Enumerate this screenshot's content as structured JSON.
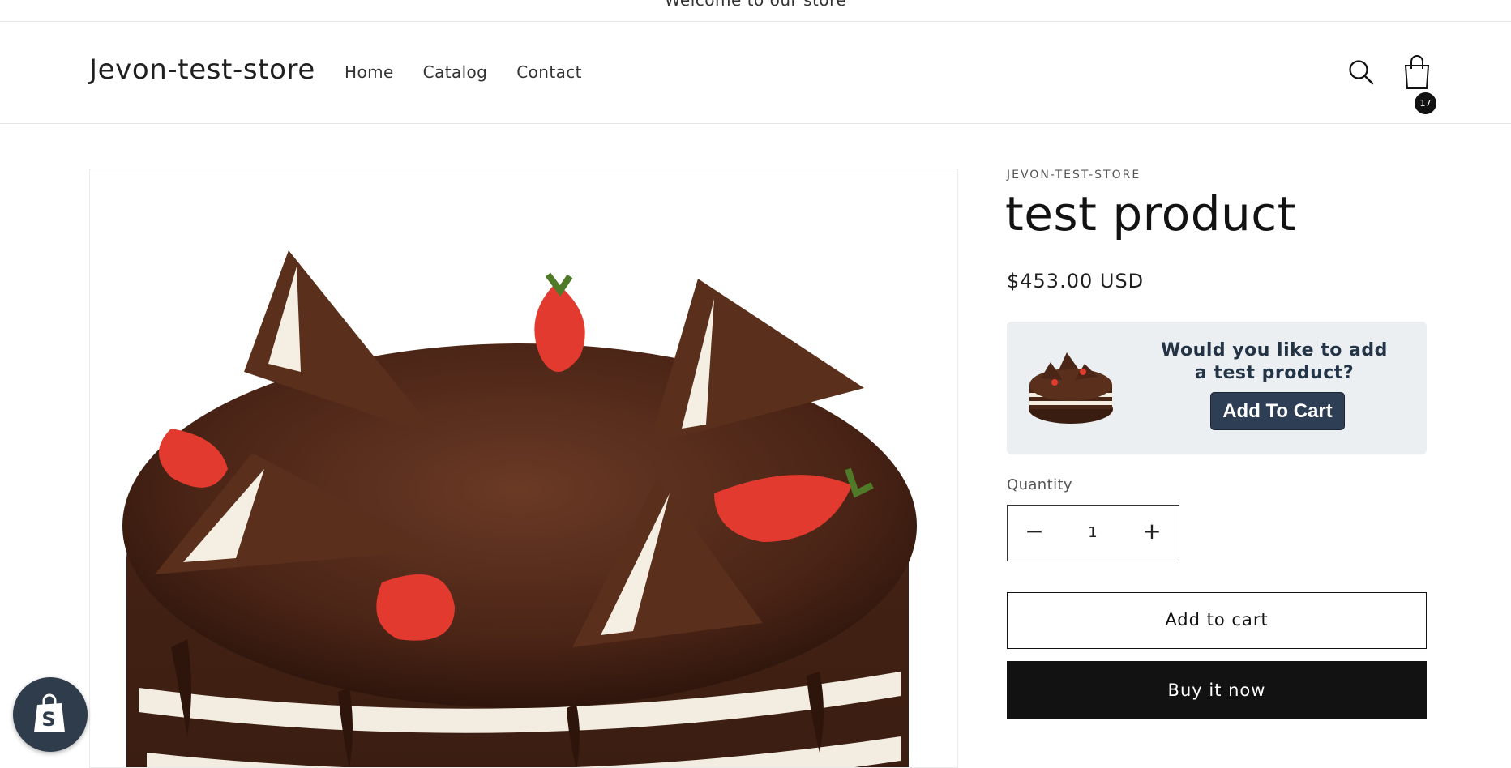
{
  "announcement": {
    "text": "Welcome to our store"
  },
  "header": {
    "logo": "Jevon-test-store",
    "nav": [
      "Home",
      "Catalog",
      "Contact"
    ],
    "cart_count": "17"
  },
  "icons": {
    "search": "search-icon",
    "cart": "cart-icon",
    "shopify": "shopify-bag-icon"
  },
  "product": {
    "vendor": "JEVON-TEST-STORE",
    "title": "test product",
    "price": "$453.00 USD",
    "quantity_label": "Quantity",
    "quantity_value": "1",
    "add_to_cart": "Add to cart",
    "buy_now": "Buy it now"
  },
  "upsell": {
    "prompt": "Would you like to add a test product?",
    "button": "Add To Cart"
  },
  "colors": {
    "primary": "#121212",
    "upsell_bg": "#eceff1",
    "upsell_button": "#2e3e54",
    "badge": "#2f3c4b"
  }
}
